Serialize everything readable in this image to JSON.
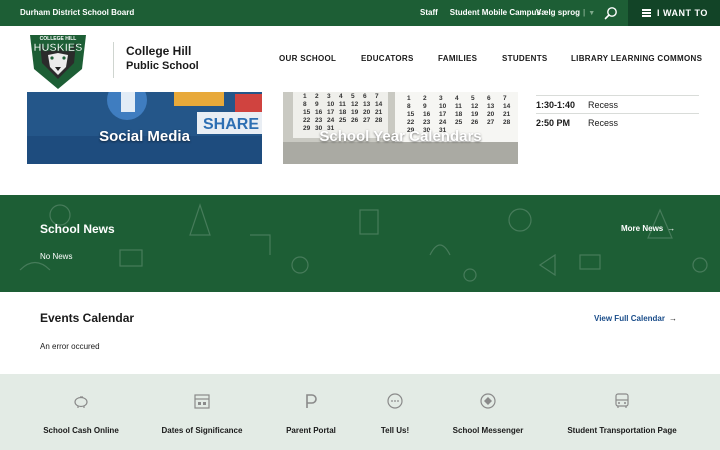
{
  "topbar": {
    "board": "Durham District School Board",
    "links": [
      "Staff",
      "Student Mobile Campus"
    ],
    "language": "Vælg sprog",
    "language_arrow": "▼",
    "i_want_to": "I WANT TO"
  },
  "header": {
    "school_line1": "College Hill",
    "school_line2": "Public School",
    "logo_text_top": "COLLEGE HILL",
    "logo_text_main": "HUSKIES",
    "nav": [
      "OUR SCHOOL",
      "EDUCATORS",
      "FAMILIES",
      "STUDENTS",
      "LIBRARY LEARNING COMMONS"
    ]
  },
  "cards": [
    {
      "label": "Social Media",
      "bg_words": [
        "SHARE"
      ]
    },
    {
      "label": "School Year Calendars"
    }
  ],
  "calendar_numbers": [
    "1",
    "2",
    "3",
    "4",
    "5",
    "6",
    "7",
    "8",
    "9",
    "10",
    "11",
    "12",
    "13",
    "14",
    "15",
    "16",
    "17",
    "18",
    "19",
    "20",
    "21",
    "22",
    "23",
    "24",
    "25",
    "26",
    "27",
    "28",
    "29",
    "30",
    "31"
  ],
  "schedule": [
    {
      "time": "1:30-1:40",
      "event": "Recess"
    },
    {
      "time": "2:50 PM",
      "event": "Recess"
    }
  ],
  "news": {
    "title": "School News",
    "more": "More News",
    "empty": "No News"
  },
  "events": {
    "title": "Events Calendar",
    "view_full": "View Full Calendar",
    "error": "An error occured"
  },
  "quick_links": [
    {
      "label": "School Cash Online",
      "icon": "piggy-bank-icon"
    },
    {
      "label": "Dates of Significance",
      "icon": "calendar-icon"
    },
    {
      "label": "Parent Portal",
      "icon": "p-logo-icon"
    },
    {
      "label": "Tell Us!",
      "icon": "chat-bubble-icon"
    },
    {
      "label": "School Messenger",
      "icon": "messenger-icon"
    },
    {
      "label": "Student Transportation Page",
      "icon": "bus-icon"
    }
  ],
  "colors": {
    "brand_green": "#1d5e35",
    "dark_green": "#124427",
    "link_blue": "#1a4d8a",
    "quick_bg": "#e3ebe5"
  }
}
